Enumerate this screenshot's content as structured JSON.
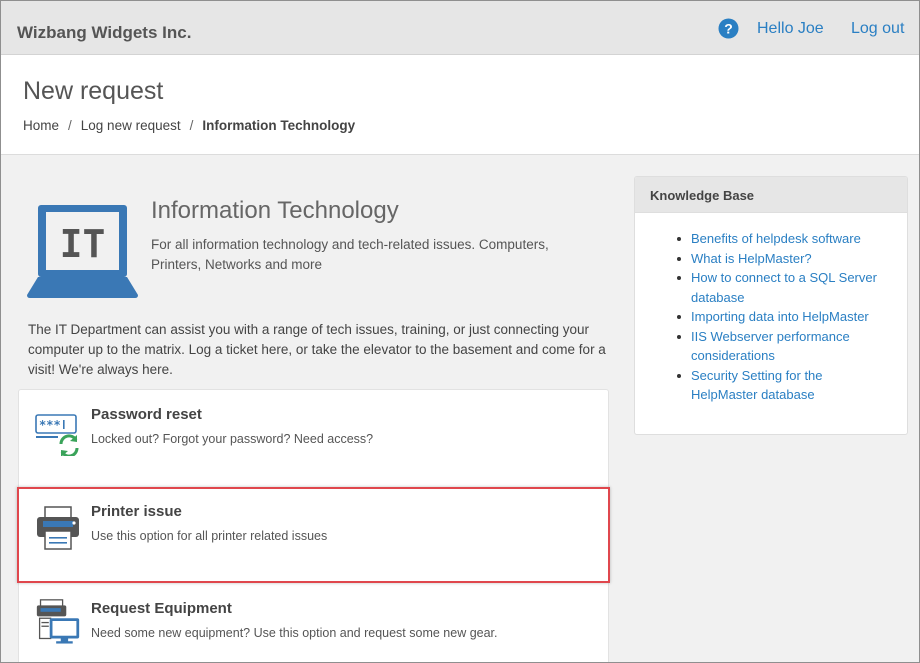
{
  "topbar": {
    "brand": "Wizbang Widgets Inc.",
    "help_icon": "question-circle-icon",
    "hello": "Hello Joe",
    "logout": "Log out"
  },
  "header": {
    "title": "New request",
    "breadcrumb": [
      "Home",
      "Log new request",
      "Information Technology"
    ]
  },
  "department": {
    "logo_text": "IT",
    "title": "Information Technology",
    "subtitle": "For all information technology and tech-related issues. Computers, Printers, Networks and more",
    "description": "The IT Department can assist you with a range of tech issues, training, or just connecting your computer up to the matrix. Log a ticket here, or take the elevator to the basement and come for a visit! We're always here."
  },
  "options": [
    {
      "title": "Password reset",
      "description": "Locked out? Forgot your password? Need access?",
      "icon": "password-reset-icon"
    },
    {
      "title": "Printer issue",
      "description": "Use this option for all printer related issues",
      "icon": "printer-icon"
    },
    {
      "title": "Request Equipment",
      "description": "Need some new equipment? Use this option and request some new gear.",
      "icon": "equipment-icon"
    }
  ],
  "knowledge_base": {
    "title": "Knowledge Base",
    "articles": [
      "Benefits of helpdesk software",
      "What is HelpMaster?",
      "How to connect to a SQL Server database",
      "Importing data into HelpMaster",
      "IIS Webserver performance considerations",
      "Security Setting for the HelpMaster database"
    ]
  },
  "colors": {
    "link": "#2a7fc3",
    "icon_blue": "#3a78b5",
    "highlight": "#e0474d",
    "refresh_green": "#3aa35a"
  }
}
